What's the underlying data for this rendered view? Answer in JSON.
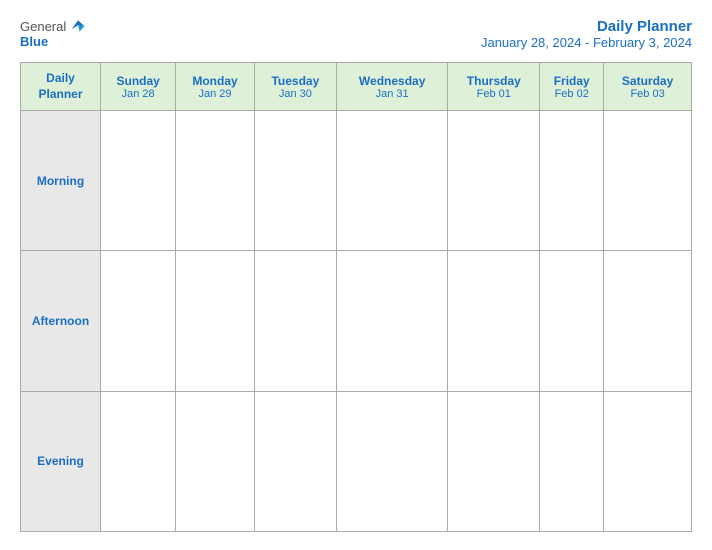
{
  "logo": {
    "general": "General",
    "blue": "Blue"
  },
  "header": {
    "title": "Daily Planner",
    "date_range": "January 28, 2024 - February 3, 2024"
  },
  "table": {
    "label_header_line1": "Daily",
    "label_header_line2": "Planner",
    "columns": [
      {
        "day": "Sunday",
        "date": "Jan 28"
      },
      {
        "day": "Monday",
        "date": "Jan 29"
      },
      {
        "day": "Tuesday",
        "date": "Jan 30"
      },
      {
        "day": "Wednesday",
        "date": "Jan 31"
      },
      {
        "day": "Thursday",
        "date": "Feb 01"
      },
      {
        "day": "Friday",
        "date": "Feb 02"
      },
      {
        "day": "Saturday",
        "date": "Feb 03"
      }
    ],
    "rows": [
      {
        "label": "Morning"
      },
      {
        "label": "Afternoon"
      },
      {
        "label": "Evening"
      }
    ]
  }
}
